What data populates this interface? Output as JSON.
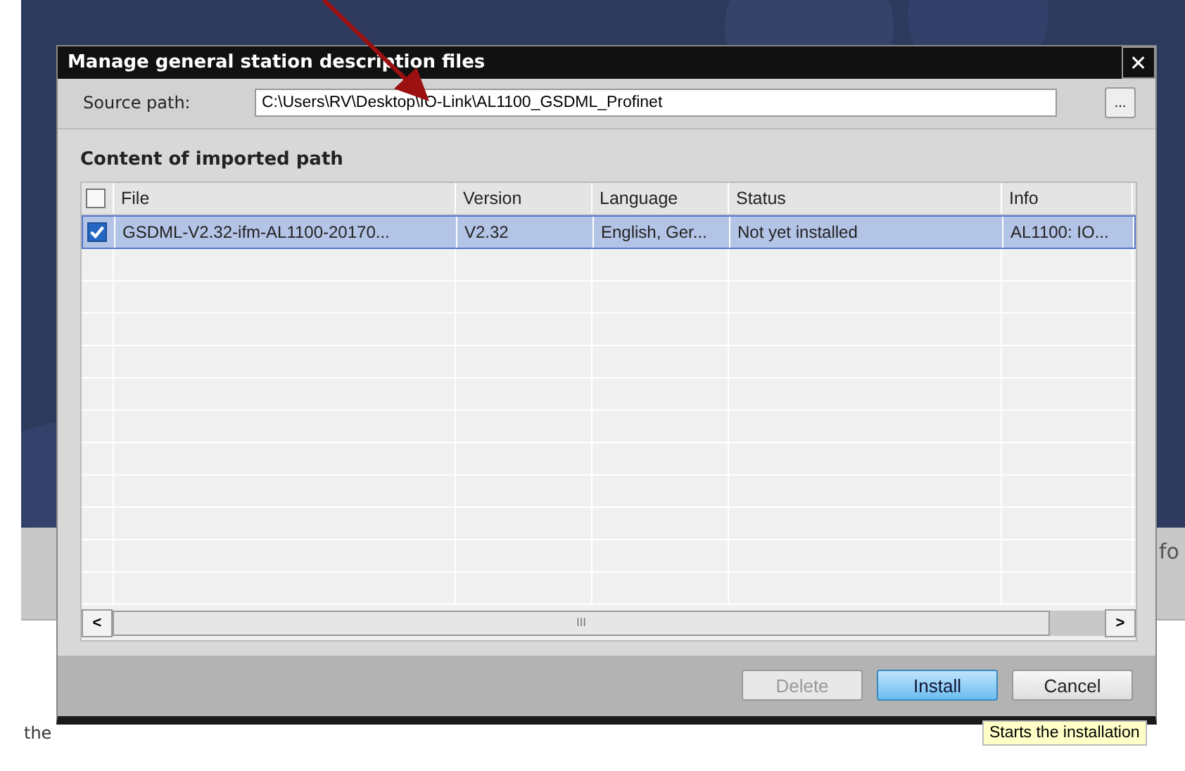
{
  "background": {
    "side_text": "fo",
    "status_text": "the"
  },
  "dialog": {
    "title": "Manage general station description files",
    "close": "✕",
    "source_path": {
      "label": "Source path:",
      "value": "C:\\Users\\RV\\Desktop\\IO-Link\\AL1100_GSDML_Profinet",
      "browse": "..."
    },
    "section_title": "Content of imported path",
    "table": {
      "header_checked": false,
      "columns": [
        "File",
        "Version",
        "Language",
        "Status",
        "Info"
      ],
      "rows": [
        {
          "checked": true,
          "selected": true,
          "cells": [
            "GSDML-V2.32-ifm-AL1100-20170...",
            "V2.32",
            "English, Ger...",
            "Not yet installed",
            "AL1100: IO..."
          ]
        }
      ],
      "scroll_left": "<",
      "scroll_right": ">",
      "scroll_thumb": "III"
    },
    "buttons": [
      {
        "label": "Delete",
        "disabled": true,
        "primary": false
      },
      {
        "label": "Install",
        "disabled": false,
        "primary": true
      },
      {
        "label": "Cancel",
        "disabled": false,
        "primary": false
      }
    ]
  },
  "tooltip": "Starts the installation"
}
